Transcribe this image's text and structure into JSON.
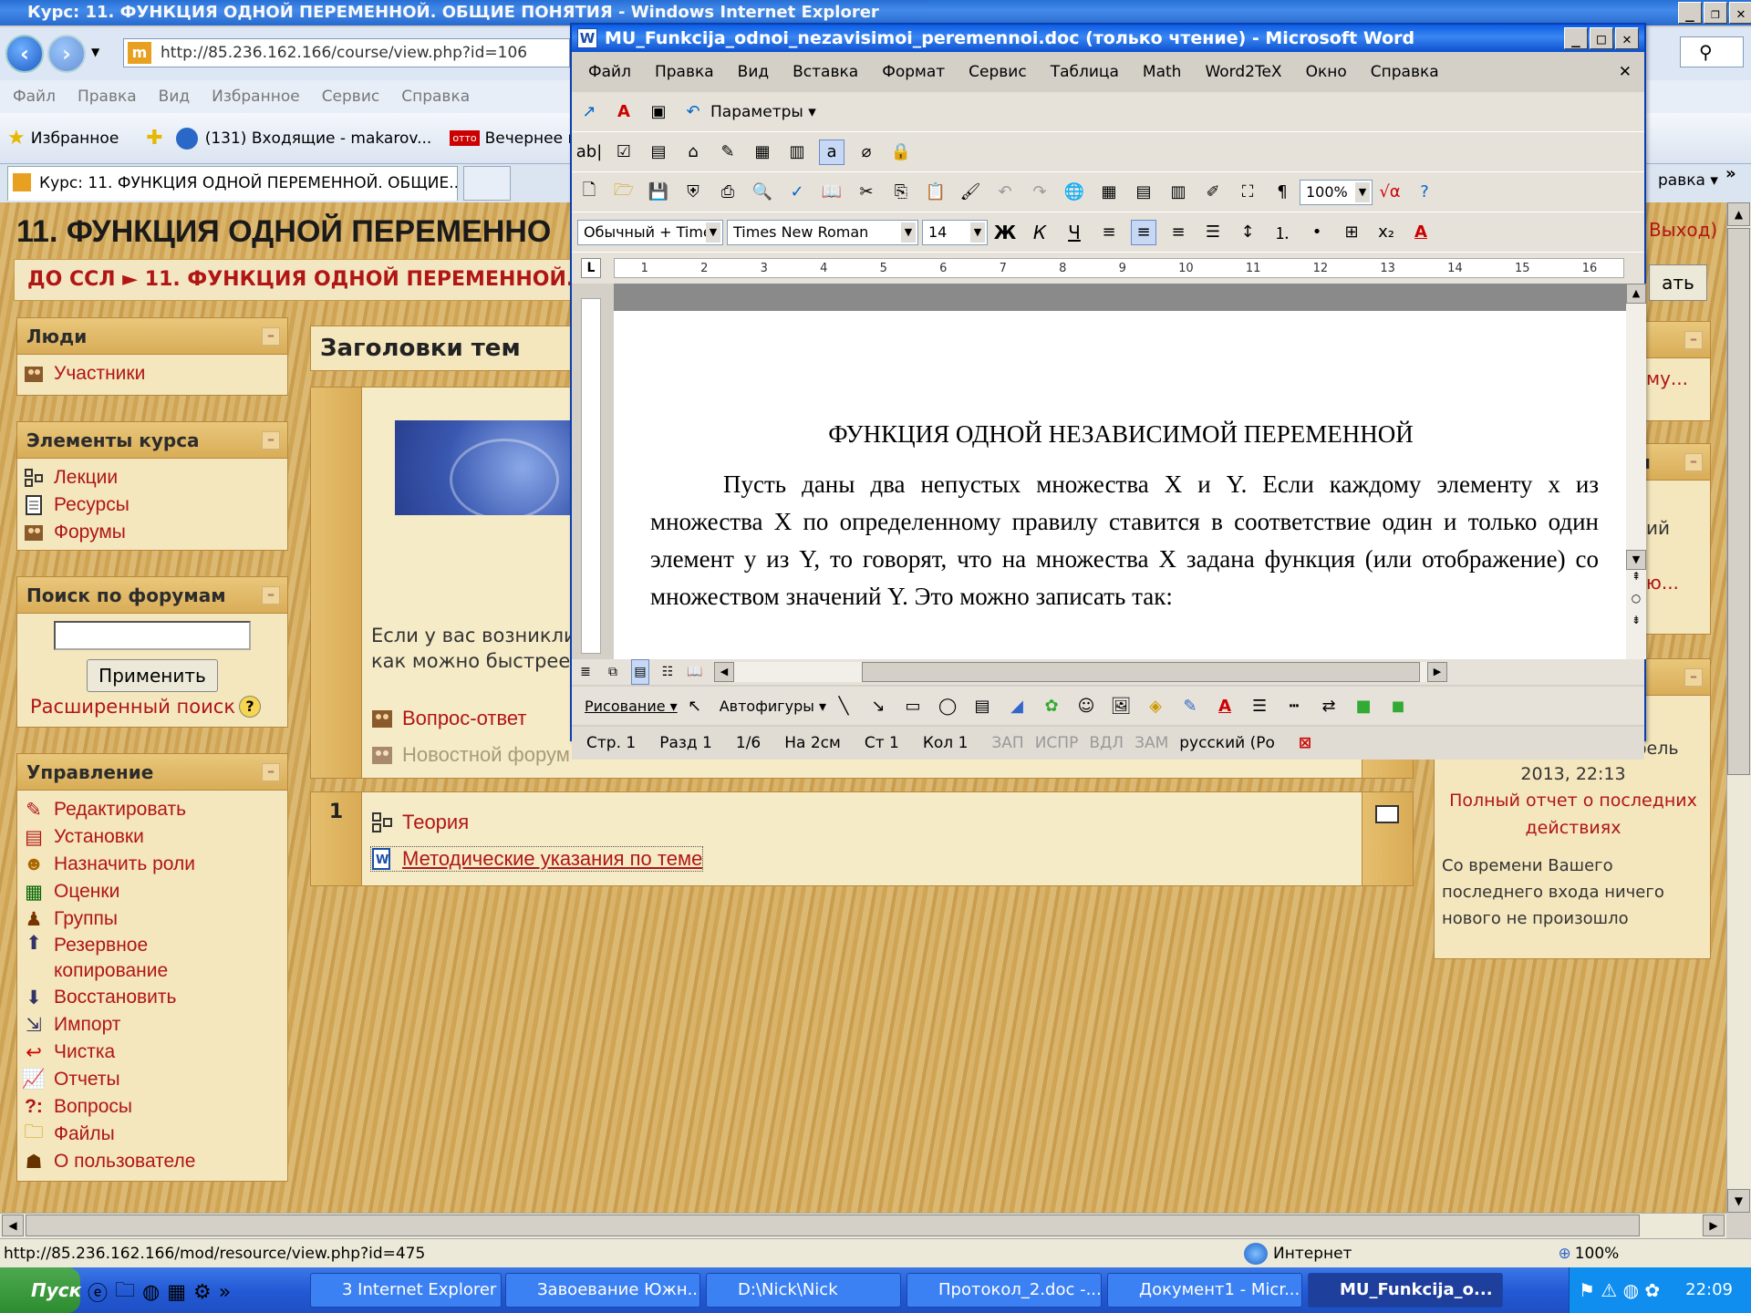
{
  "ie": {
    "title": "Курс: 11. ФУНКЦИЯ ОДНОЙ ПЕРЕМЕННОЙ. ОБЩИЕ ПОНЯТИЯ - Windows Internet Explorer",
    "address": "http://85.236.162.166/course/view.php?id=106",
    "menu": [
      "Файл",
      "Правка",
      "Вид",
      "Избранное",
      "Сервис",
      "Справка"
    ],
    "favorites_label": "Избранное",
    "fav_links": [
      "(131) Входящие - makarov...",
      "Вечернее п"
    ],
    "tab_title": "Курс: 11. ФУНКЦИЯ ОДНОЙ ПЕРЕМЕННОЙ. ОБЩИЕ...",
    "right_menu_label": "равка",
    "status_url": "http://85.236.162.166/mod/resource/view.php?id=475",
    "status_zone": "Интернет",
    "zoom": "100%"
  },
  "moodle": {
    "header_title": "11. ФУНКЦИЯ ОДНОЙ ПЕРЕМЕННО",
    "breadcrumb": "ДО ССЛ ► 11. ФУНКЦИЯ ОДНОЙ ПЕРЕМЕННОЙ. ОБ",
    "logout_label": "Выход)",
    "edit_button": "ать",
    "people": {
      "title": "Люди",
      "items": [
        {
          "label": "Участники",
          "icon": "users-icon"
        }
      ]
    },
    "activities": {
      "title": "Элементы курса",
      "items": [
        {
          "label": "Лекции",
          "icon": "lesson-icon"
        },
        {
          "label": "Ресурсы",
          "icon": "resource-icon"
        },
        {
          "label": "Форумы",
          "icon": "forum-icon"
        }
      ]
    },
    "search": {
      "title": "Поиск по форумам",
      "button": "Применить",
      "advanced": "Расширенный поиск"
    },
    "admin": {
      "title": "Управление",
      "items": [
        {
          "label": "Редактировать",
          "icon": "edit-icon"
        },
        {
          "label": "Установки",
          "icon": "settings-icon"
        },
        {
          "label": "Назначить роли",
          "icon": "roles-icon"
        },
        {
          "label": "Оценки",
          "icon": "grades-icon"
        },
        {
          "label": "Группы",
          "icon": "groups-icon"
        },
        {
          "label": "Резервное копирование",
          "icon": "backup-icon"
        },
        {
          "label": "Восстановить",
          "icon": "restore-icon"
        },
        {
          "label": "Импорт",
          "icon": "import-icon"
        },
        {
          "label": "Чистка",
          "icon": "reset-icon"
        },
        {
          "label": "Отчеты",
          "icon": "reports-icon"
        },
        {
          "label": "Вопросы",
          "icon": "questions-icon"
        },
        {
          "label": "Файлы",
          "icon": "folder-icon"
        },
        {
          "label": "О пользователе",
          "icon": "profile-icon"
        }
      ]
    },
    "topics_title": "Заголовки тем",
    "section0": {
      "text_line1": "Если у вас возникли",
      "text_line2": "как можно быстрее",
      "links": [
        {
          "label": "Вопрос-ответ",
          "icon": "forum-icon"
        },
        {
          "label": "Новостной форум",
          "icon": "forum-icon"
        }
      ]
    },
    "section1": {
      "number": "1",
      "links": [
        {
          "label": "Теория",
          "icon": "lesson-icon"
        },
        {
          "label": "Методические указания по теме",
          "icon": "word-doc-icon"
        }
      ]
    },
    "right_blocks": {
      "news_fragment": "му...",
      "block2_title_fragment": "ия",
      "block2_line1": "ий",
      "block2_line2": "ю...",
      "recent_date_line1": "Понедельник 8 Апрель",
      "recent_date_line2": "2013, 22:13",
      "recent_report_link": "Полный отчет о последних действиях",
      "recent_nothing": "Со времени Вашего последнего входа ничего нового не произошло"
    }
  },
  "word": {
    "title": "MU_Funkcija_odnoi_nezavisimoi_peremennoi.doc (только чтение) - Microsoft Word",
    "menu": [
      "Файл",
      "Правка",
      "Вид",
      "Вставка",
      "Формат",
      "Сервис",
      "Таблица",
      "Math",
      "Word2TeX",
      "Окно",
      "Справка"
    ],
    "params_label": "Параметры",
    "zoom": "100%",
    "style": "Обычный + Time",
    "font": "Times New Roman",
    "size": "14",
    "bold": "Ж",
    "italic": "К",
    "underline": "Ч",
    "ruler_marks": [
      "1",
      "2",
      "3",
      "4",
      "5",
      "6",
      "7",
      "8",
      "9",
      "10",
      "11",
      "12",
      "13",
      "14",
      "15",
      "16"
    ],
    "doc_title": "ФУНКЦИЯ ОДНОЙ НЕЗАВИСИМОЙ ПЕРЕМЕННОЙ",
    "doc_paragraph": "Пусть даны два непустых множества X и Y. Если каждому элементу x из множества X по определенному правилу ставится в соответствие один и только один элемент y из Y, то говорят, что на множества X задана функция (или отображение) со множеством значений Y. Это можно записать так:",
    "draw_label": "Рисование",
    "autoshapes_label": "Автофигуры",
    "status": {
      "page": "Стр. 1",
      "section": "Разд 1",
      "pages": "1/6",
      "at": "На 2см",
      "line": "Ст 1",
      "col": "Кол 1",
      "rec": "ЗАП",
      "trk": "ИСПР",
      "ext": "ВДЛ",
      "ovr": "ЗАМ",
      "lang": "русский (Ро"
    }
  },
  "taskbar": {
    "start": "Пуск",
    "buttons": [
      {
        "label": "3 Internet Explorer",
        "active": false
      },
      {
        "label": "Завоевание Южн...",
        "active": false
      },
      {
        "label": "D:\\Nick\\Nick",
        "active": false
      },
      {
        "label": "Протокол_2.doc -...",
        "active": false
      },
      {
        "label": "Документ1 - Micr...",
        "active": false
      },
      {
        "label": "MU_Funkcija_o...",
        "active": true
      }
    ],
    "clock": "22:09"
  }
}
